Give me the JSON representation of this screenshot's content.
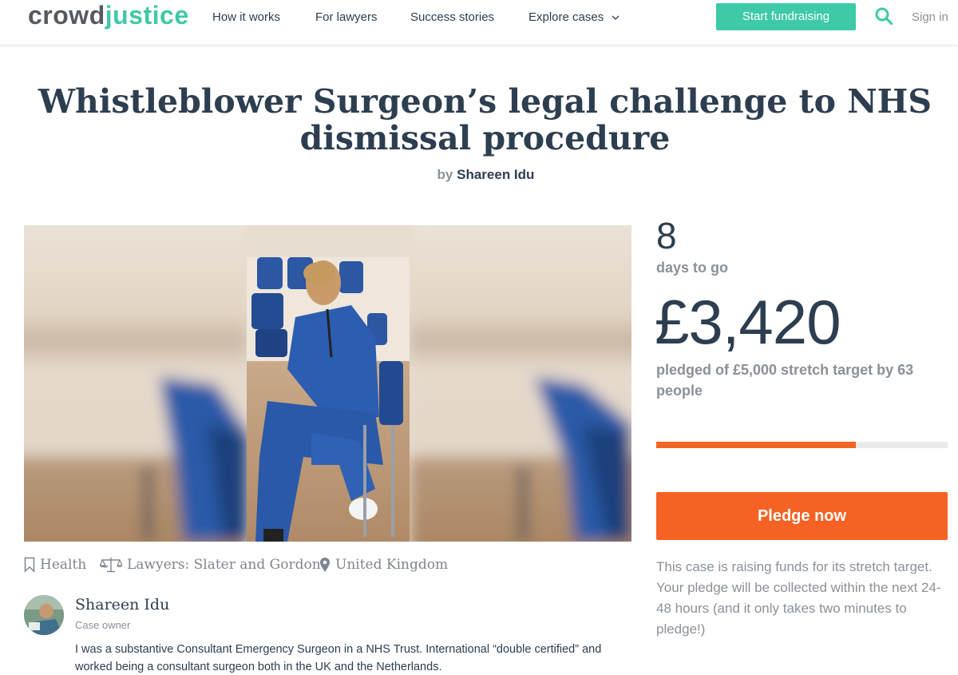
{
  "header": {
    "logo_part1": "crowd",
    "logo_part2": "justice",
    "nav": [
      {
        "label": "How it works"
      },
      {
        "label": "For lawyers"
      },
      {
        "label": "Success stories"
      },
      {
        "label": "Explore cases"
      }
    ],
    "start_button": "Start fundraising",
    "search_icon": "search-icon",
    "sign_in": "Sign in"
  },
  "case": {
    "title": "Whistleblower Surgeon’s legal challenge to NHS dismissal procedure",
    "by_label": "by",
    "owner": "Shareen Idu",
    "tags": {
      "category": "Health",
      "lawyers": "Lawyers: Slater and Gordon",
      "location": "United Kingdom"
    },
    "owner_card": {
      "name": "Shareen Idu",
      "role": "Case owner",
      "description": "I was a substantive Consultant Emergency Surgeon in a NHS Trust. International “double certified” and worked being a consultant surgeon both in the UK and the Netherlands."
    }
  },
  "funding": {
    "days": "8",
    "days_label": "days to go",
    "amount": "£3,420",
    "pledged_text": "pledged of £5,000 stretch target by 63 people",
    "progress_fraction": 0.684,
    "pledge_button": "Pledge now",
    "info": "This case is raising funds for its stretch target. Your pledge will be collected within the next 24-48 hours (and it only takes two minutes to pledge!)"
  },
  "colors": {
    "brand_teal": "#3ec9a7",
    "accent_orange": "#f66223",
    "text_dark": "#2d3e50",
    "text_muted": "#8a9199"
  }
}
